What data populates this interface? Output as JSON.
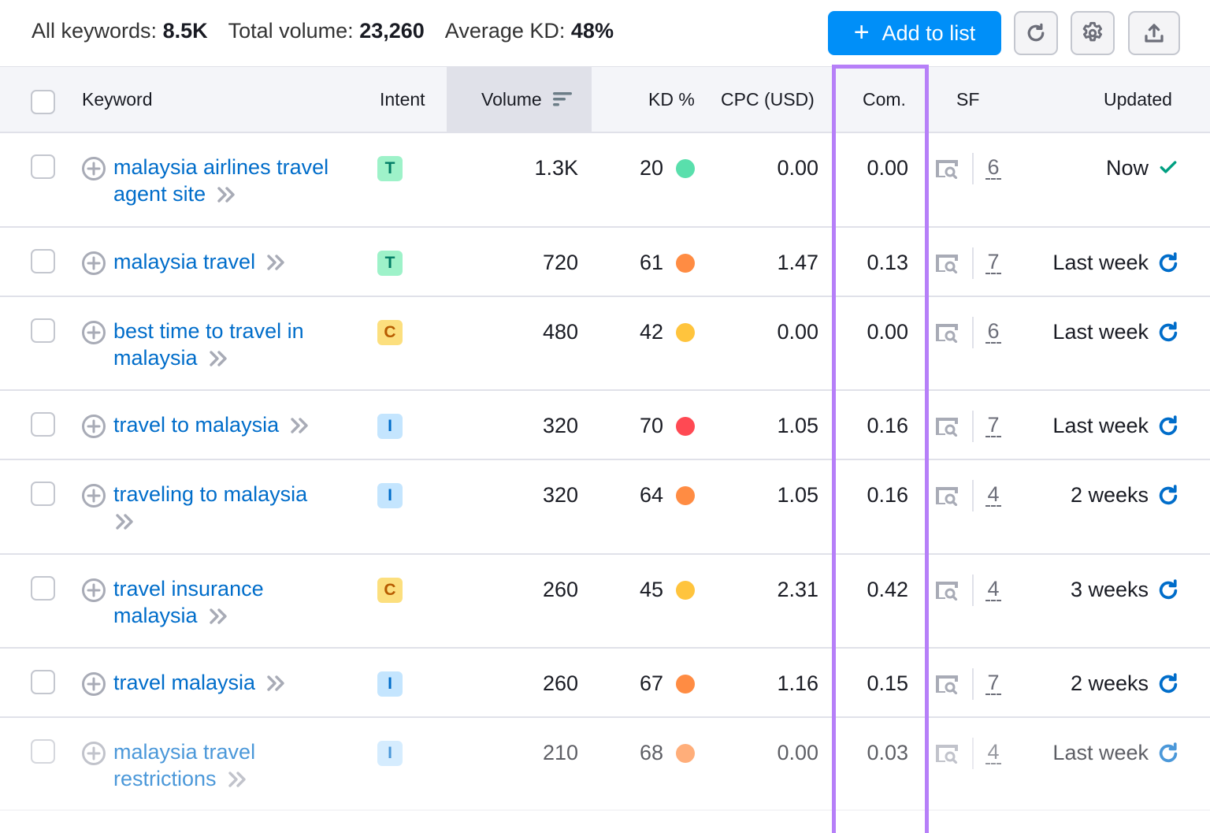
{
  "summary": {
    "all_keywords_label": "All keywords:",
    "all_keywords_value": "8.5K",
    "total_volume_label": "Total volume:",
    "total_volume_value": "23,260",
    "average_kd_label": "Average KD:",
    "average_kd_value": "48%"
  },
  "toolbar": {
    "add_to_list_label": "Add to list",
    "add_icon": "plus-icon",
    "refresh_icon": "refresh-icon",
    "settings_icon": "gear-icon",
    "export_icon": "export-icon"
  },
  "columns": {
    "keyword": "Keyword",
    "intent": "Intent",
    "volume": "Volume",
    "kd": "KD %",
    "cpc": "CPC (USD)",
    "com": "Com.",
    "sf": "SF",
    "updated": "Updated"
  },
  "colors": {
    "accent": "#008ff8",
    "link": "#006dca",
    "highlight": "#b67ff8",
    "kd_easy": "#59dfac",
    "kd_hard": "#ff8c43",
    "kd_possible": "#ffc43d",
    "kd_very_hard": "#ff4953",
    "updated_check": "#009f81"
  },
  "rows": [
    {
      "keyword_line1": "malaysia airlines travel",
      "keyword_line2": "agent site",
      "intent": "T",
      "volume": "1.3K",
      "kd": "20",
      "kd_color": "#59dfac",
      "cpc": "0.00",
      "com": "0.00",
      "sf": "6",
      "updated": "Now",
      "updated_icon": "check-icon"
    },
    {
      "keyword_line1": "malaysia travel",
      "keyword_line2": "",
      "intent": "T",
      "volume": "720",
      "kd": "61",
      "kd_color": "#ff8c43",
      "cpc": "1.47",
      "com": "0.13",
      "sf": "7",
      "updated": "Last week",
      "updated_icon": "refresh-icon"
    },
    {
      "keyword_line1": "best time to travel in",
      "keyword_line2": "malaysia",
      "intent": "C",
      "volume": "480",
      "kd": "42",
      "kd_color": "#ffc43d",
      "cpc": "0.00",
      "com": "0.00",
      "sf": "6",
      "updated": "Last week",
      "updated_icon": "refresh-icon"
    },
    {
      "keyword_line1": "travel to malaysia",
      "keyword_line2": "",
      "intent": "I",
      "volume": "320",
      "kd": "70",
      "kd_color": "#ff4953",
      "cpc": "1.05",
      "com": "0.16",
      "sf": "7",
      "updated": "Last week",
      "updated_icon": "refresh-icon"
    },
    {
      "keyword_line1": "traveling to malaysia",
      "keyword_line2": "",
      "intent": "I",
      "volume": "320",
      "kd": "64",
      "kd_color": "#ff8c43",
      "cpc": "1.05",
      "com": "0.16",
      "sf": "4",
      "updated": "2 weeks",
      "updated_icon": "refresh-icon"
    },
    {
      "keyword_line1": "travel insurance",
      "keyword_line2": "malaysia",
      "intent": "C",
      "volume": "260",
      "kd": "45",
      "kd_color": "#ffc43d",
      "cpc": "2.31",
      "com": "0.42",
      "sf": "4",
      "updated": "3 weeks",
      "updated_icon": "refresh-icon"
    },
    {
      "keyword_line1": "travel malaysia",
      "keyword_line2": "",
      "intent": "I",
      "volume": "260",
      "kd": "67",
      "kd_color": "#ff8c43",
      "cpc": "1.16",
      "com": "0.15",
      "sf": "7",
      "updated": "2 weeks",
      "updated_icon": "refresh-icon"
    },
    {
      "keyword_line1": "malaysia travel",
      "keyword_line2": "restrictions",
      "intent": "I",
      "volume": "210",
      "kd": "68",
      "kd_color": "#ff8c43",
      "cpc": "0.00",
      "com": "0.03",
      "sf": "4",
      "updated": "Last week",
      "updated_icon": "refresh-icon"
    }
  ]
}
